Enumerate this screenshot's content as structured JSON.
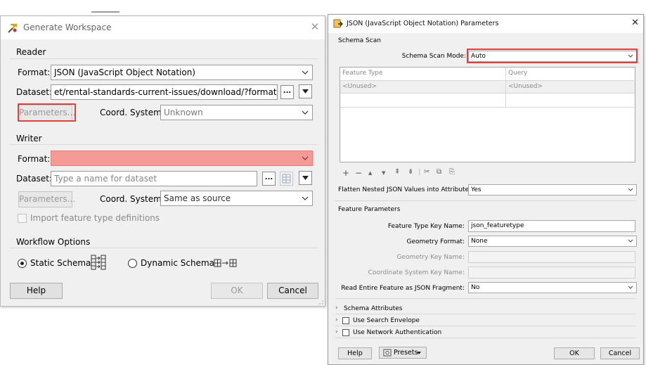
{
  "generate_workspace": {
    "title": "Generate Workspace",
    "close": "✕",
    "reader": {
      "group_label": "Reader",
      "format_label": "Format:",
      "format_value": "JSON (JavaScript Object Notation)",
      "dataset_label": "Dataset:",
      "dataset_value": "et/rental-standards-current-issues/download/?format=json:",
      "browse": "...",
      "parameters_button": "Parameters...",
      "coord_label": "Coord. System:",
      "coord_value": "Unknown"
    },
    "writer": {
      "group_label": "Writer",
      "format_label": "Format:",
      "format_value": "",
      "dataset_label": "Dataset:",
      "dataset_placeholder": "Type a name for dataset",
      "browse": "...",
      "parameters_button": "Parameters...",
      "coord_label": "Coord. System:",
      "coord_value": "Same as source",
      "import_label": "Import feature type definitions"
    },
    "workflow": {
      "group_label": "Workflow Options",
      "static_label": "Static Schema",
      "dynamic_label": "Dynamic Schema",
      "selected": "Static Schema"
    },
    "help_button": "Help",
    "ok_button": "OK",
    "cancel_button": "Cancel"
  },
  "json_params": {
    "title": "JSON (JavaScript Object Notation) Parameters",
    "close": "✕",
    "schema_scan": {
      "section_label": "Schema Scan",
      "mode_label": "Schema Scan Mode:",
      "mode_value": "Auto",
      "columns": [
        "Feature Type",
        "Query"
      ],
      "rows": [
        [
          "<Unused>",
          "<Unused>"
        ]
      ],
      "flatten_label": "Flatten Nested JSON Values into Attributes:",
      "flatten_value": "Yes"
    },
    "feature_parameters": {
      "section_label": "Feature Parameters",
      "key_name_label": "Feature Type Key Name:",
      "key_name_value": "json_featuretype",
      "geometry_format_label": "Geometry Format:",
      "geometry_format_value": "None",
      "geometry_key_label": "Geometry Key Name:",
      "coord_key_label": "Coordinate System Key Name:",
      "read_entire_label": "Read Entire Feature as JSON Fragment:",
      "read_entire_value": "No"
    },
    "schema_attributes": "Schema Attributes",
    "use_search_envelope": "Use Search Envelope",
    "use_network_auth": "Use Network Authentication",
    "help_button": "Help",
    "presets_button": "Presets",
    "ok_button": "OK",
    "cancel_button": "Cancel"
  },
  "colors": {
    "highlight": "#e0403c",
    "invalid_field": "#f49b97"
  }
}
